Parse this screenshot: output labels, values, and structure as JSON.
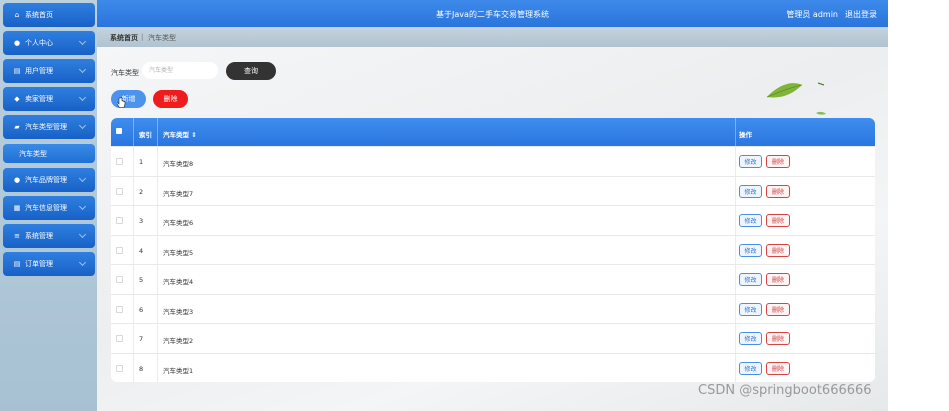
{
  "app": {
    "title": "基于Java的二手车交易管理系统",
    "user": "管理员 admin",
    "logout": "退出登录"
  },
  "sidebar": {
    "items": [
      {
        "label": "系统首页",
        "icon": "home-icon",
        "glyph": "⌂"
      },
      {
        "label": "个人中心",
        "icon": "person-icon",
        "glyph": "●"
      },
      {
        "label": "用户管理",
        "icon": "document-icon",
        "glyph": "▤"
      },
      {
        "label": "卖家管理",
        "icon": "location-pin-icon",
        "glyph": "◆"
      },
      {
        "label": "汽车类型管理",
        "icon": "folder-icon",
        "glyph": "▰"
      },
      {
        "label": "汽车品牌管理",
        "icon": "person-icon",
        "glyph": "●"
      },
      {
        "label": "汽车信息管理",
        "icon": "grid-icon",
        "glyph": "▦"
      },
      {
        "label": "系统管理",
        "icon": "list-icon",
        "glyph": "≡"
      },
      {
        "label": "订单管理",
        "icon": "document-icon",
        "glyph": "▤"
      }
    ],
    "subitem": "汽车类型"
  },
  "breadcrumb": {
    "home": "系统首页",
    "separator": "|",
    "current": "汽车类型"
  },
  "search": {
    "label": "汽车类型",
    "placeholder": "汽车类型",
    "value": "",
    "query_button": "查询"
  },
  "actions": {
    "add_button": "新增",
    "delete_button": "删除"
  },
  "table": {
    "headers": {
      "index": "索引",
      "type": "汽车类型 ⇕",
      "action": "操作"
    },
    "rows": [
      {
        "index": "1",
        "type": "汽车类型8"
      },
      {
        "index": "2",
        "type": "汽车类型7"
      },
      {
        "index": "3",
        "type": "汽车类型6"
      },
      {
        "index": "4",
        "type": "汽车类型5"
      },
      {
        "index": "5",
        "type": "汽车类型4"
      },
      {
        "index": "6",
        "type": "汽车类型3"
      },
      {
        "index": "7",
        "type": "汽车类型2"
      },
      {
        "index": "8",
        "type": "汽车类型1"
      }
    ],
    "edit_label": "修改",
    "delete_label": "删除"
  },
  "watermark": "CSDN @springboot666666",
  "colors": {
    "primary": "#2a76e0",
    "danger": "#ee1c1c",
    "dark_button": "#333333"
  }
}
